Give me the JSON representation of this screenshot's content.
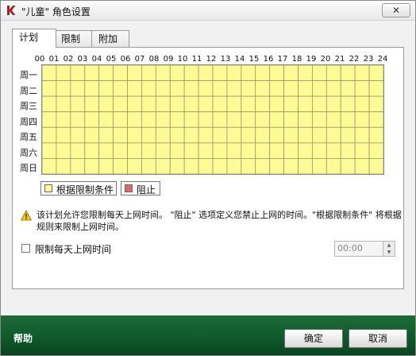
{
  "window": {
    "title": "\"儿童\" 角色设置",
    "close_label": "✕"
  },
  "tabs": [
    {
      "label": "计划",
      "active": true
    },
    {
      "label": "限制",
      "active": false
    },
    {
      "label": "附加",
      "active": false
    }
  ],
  "schedule": {
    "hours": [
      "00",
      "01",
      "02",
      "03",
      "04",
      "05",
      "06",
      "07",
      "08",
      "09",
      "10",
      "11",
      "12",
      "13",
      "14",
      "15",
      "16",
      "17",
      "18",
      "19",
      "20",
      "21",
      "22",
      "23",
      "24"
    ],
    "days": [
      "周一",
      "周二",
      "周三",
      "周四",
      "周五",
      "周六",
      "周日"
    ],
    "cell_color": "#fdfb96",
    "grid_line_color": "#9a9a6a",
    "all_cells_state": "根据限制条件"
  },
  "legend": [
    {
      "label": "根据限制条件",
      "color": "#fdfb96"
    },
    {
      "label": "阻止",
      "color": "#e06a6a"
    }
  ],
  "info": {
    "icon": "warning-icon",
    "text": "该计划允许您限制每天上网时间。 \"阻止\" 选项定义您禁止上网的时间。\"根据限制条件\" 将根据规则来限制上网时间。"
  },
  "limit_daily": {
    "label": "限制每天上网时间",
    "checked": false,
    "time_value": "00:00"
  },
  "footer": {
    "help_label": "帮助",
    "ok_label": "确定",
    "cancel_label": "取消",
    "background": "#0e5a2b"
  }
}
